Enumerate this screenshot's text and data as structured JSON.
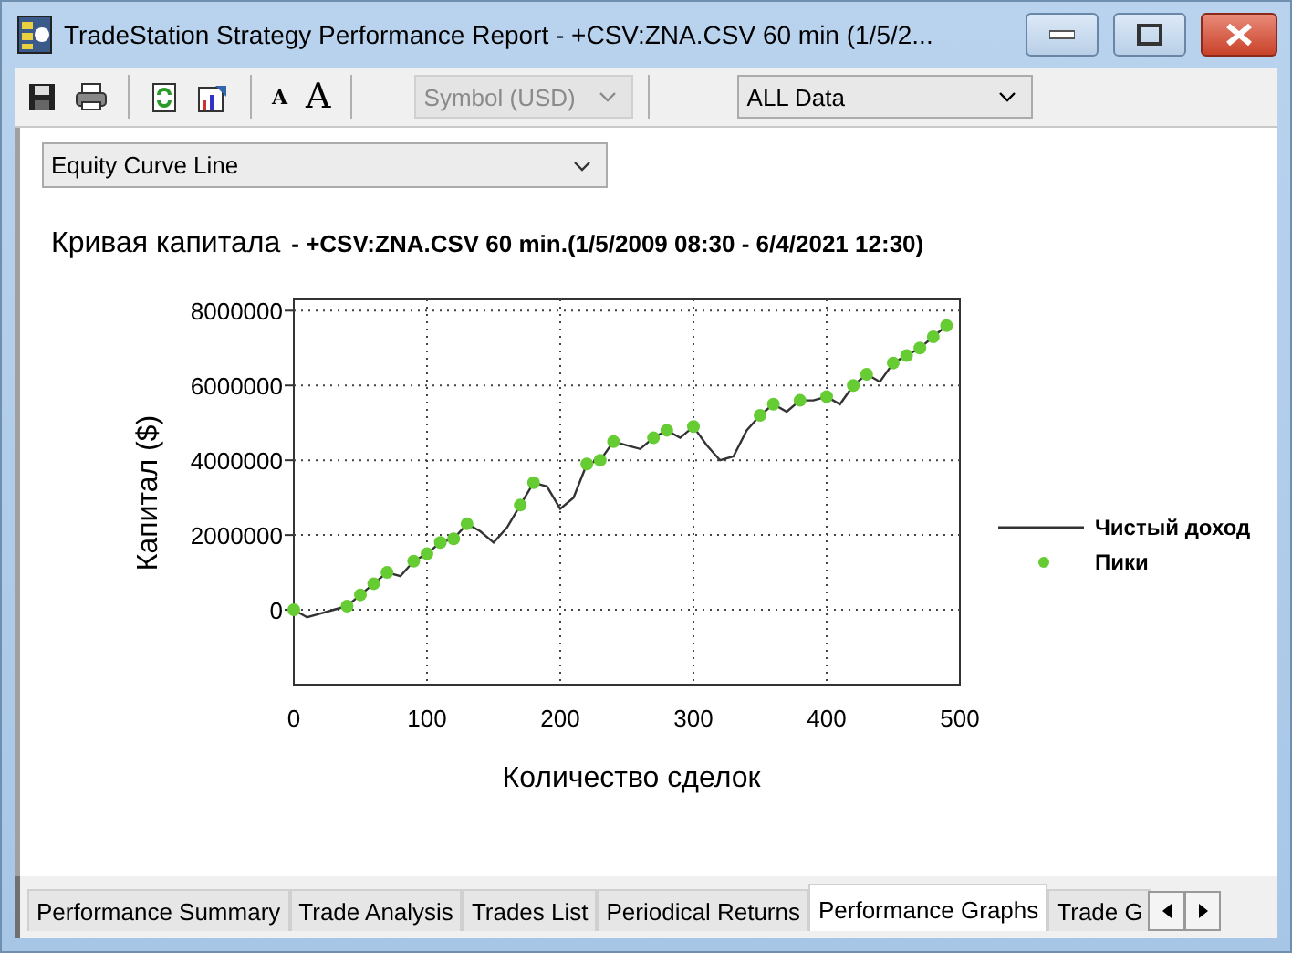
{
  "window": {
    "title": "TradeStation Strategy Performance Report - +CSV:ZNA.CSV 60 min (1/5/2..."
  },
  "toolbar": {
    "buttons": [
      {
        "kind": "save"
      },
      {
        "kind": "print"
      },
      {
        "kind": "refresh"
      },
      {
        "kind": "chart"
      },
      {
        "kind": "font-smaller",
        "label": "A"
      },
      {
        "kind": "font-larger",
        "label": "A"
      }
    ],
    "symbol_select": {
      "value": "Symbol (USD)",
      "disabled": true
    },
    "range_select": {
      "value": "ALL Data",
      "disabled": false
    }
  },
  "graph_select": {
    "value": "Equity Curve Line"
  },
  "chart_title": {
    "main": "Кривая капитала",
    "subtitle": "- +CSV:ZNA.CSV 60 min.(1/5/2009 08:30 - 6/4/2021 12:30)"
  },
  "chart_data": {
    "type": "line",
    "xlabel": "Количество сделок",
    "ylabel": "Капитал ($)",
    "x": [
      0,
      10,
      20,
      30,
      40,
      50,
      60,
      70,
      80,
      90,
      100,
      110,
      120,
      130,
      140,
      150,
      160,
      170,
      180,
      190,
      200,
      210,
      220,
      230,
      240,
      250,
      260,
      270,
      280,
      290,
      300,
      310,
      320,
      330,
      340,
      350,
      360,
      370,
      380,
      390,
      400,
      410,
      420,
      430,
      440,
      450,
      460,
      470,
      480,
      490
    ],
    "series": [
      {
        "name": "Чистый доход",
        "type": "line",
        "color": "#333333",
        "values": [
          0,
          -200000,
          -100000,
          0,
          100000,
          400000,
          700000,
          1000000,
          900000,
          1300000,
          1500000,
          1800000,
          1900000,
          2300000,
          2100000,
          1800000,
          2200000,
          2800000,
          3400000,
          3300000,
          2700000,
          3000000,
          3900000,
          4000000,
          4500000,
          4400000,
          4300000,
          4600000,
          4800000,
          4600000,
          4900000,
          4400000,
          4000000,
          4100000,
          4800000,
          5200000,
          5500000,
          5300000,
          5600000,
          5600000,
          5700000,
          5500000,
          6000000,
          6300000,
          6100000,
          6600000,
          6800000,
          7000000,
          7300000,
          7600000
        ]
      },
      {
        "name": "Пики",
        "type": "scatter",
        "color": "#66cc33",
        "values": [
          0,
          null,
          null,
          null,
          100000,
          400000,
          700000,
          1000000,
          null,
          1300000,
          1500000,
          1800000,
          1900000,
          2300000,
          null,
          null,
          null,
          2800000,
          3400000,
          null,
          null,
          null,
          3900000,
          4000000,
          4500000,
          null,
          null,
          4600000,
          4800000,
          null,
          4900000,
          null,
          null,
          null,
          null,
          5200000,
          5500000,
          null,
          5600000,
          null,
          5700000,
          null,
          6000000,
          6300000,
          null,
          6600000,
          6800000,
          7000000,
          7300000,
          7600000
        ]
      }
    ],
    "grid": true,
    "legend": "right",
    "xlim": [
      0,
      500
    ],
    "ylim": [
      -2000000,
      8300000
    ],
    "xticks": [
      0,
      100,
      200,
      300,
      400,
      500
    ],
    "yticks": [
      0,
      2000000,
      4000000,
      6000000,
      8000000
    ]
  },
  "tabs": [
    {
      "label": "Performance Summary",
      "selected": false
    },
    {
      "label": "Trade Analysis",
      "selected": false
    },
    {
      "label": "Trades List",
      "selected": false
    },
    {
      "label": "Periodical Returns",
      "selected": false
    },
    {
      "label": "Performance Graphs",
      "selected": true
    },
    {
      "label": "Trade G",
      "selected": false
    }
  ]
}
